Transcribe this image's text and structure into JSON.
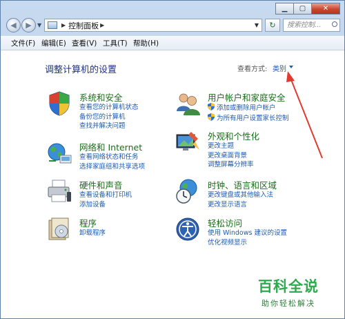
{
  "address": {
    "path": "控制面板",
    "search_placeholder": "搜索控制..."
  },
  "menubar": [
    "文件(F)",
    "编辑(E)",
    "查看(V)",
    "工具(T)",
    "帮助(H)"
  ],
  "page_title": "调整计算机的设置",
  "view_by": {
    "label": "查看方式:",
    "value": "类别"
  },
  "categories": {
    "system": {
      "title": "系统和安全",
      "links": [
        "查看您的计算机状态",
        "备份您的计算机",
        "查找并解决问题"
      ]
    },
    "users": {
      "title": "用户帐户和家庭安全",
      "links": [
        "添加或删除用户帐户",
        "为所有用户设置家长控制"
      ]
    },
    "network": {
      "title": "网络和 Internet",
      "links": [
        "查看网络状态和任务",
        "选择家庭组和共享选项"
      ]
    },
    "appearance": {
      "title": "外观和个性化",
      "links": [
        "更改主题",
        "更改桌面背景",
        "调整屏幕分辨率"
      ]
    },
    "hardware": {
      "title": "硬件和声音",
      "links": [
        "查看设备和打印机",
        "添加设备"
      ]
    },
    "clock": {
      "title": "时钟、语言和区域",
      "links": [
        "更改键盘或其他输入法",
        "更改显示语言"
      ]
    },
    "programs": {
      "title": "程序",
      "links": [
        "卸载程序"
      ]
    },
    "access": {
      "title": "轻松访问",
      "links": [
        "使用 Windows 建议的设置",
        "优化视频显示"
      ]
    }
  },
  "watermark": {
    "main": "百科全说",
    "sub": "助你轻松解决"
  }
}
